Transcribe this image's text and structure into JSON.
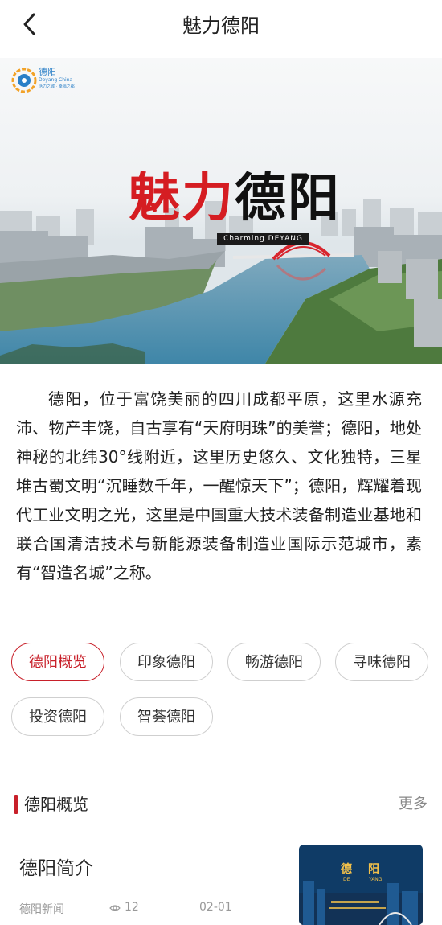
{
  "header": {
    "title": "魅力德阳"
  },
  "hero": {
    "logo_name": "德阳",
    "logo_sub": "Deyang China",
    "logo_tag": "活力之城 · 幸福之都",
    "brand_part1": "魅力",
    "brand_part2": "德阳",
    "brand_en": "Charming DEYANG"
  },
  "intro": "德阳，位于富饶美丽的四川成都平原，这里水源充沛、物产丰饶，自古享有“天府明珠”的美誉；德阳，地处神秘的北纬30°线附近，这里历史悠久、文化独特，三星堆古蜀文明“沉睡数千年，一醒惊天下”；德阳，辉耀着现代工业文明之光，这里是中国重大技术装备制造业基地和联合国清洁技术与新能源装备制造业国际示范城市，素有“智造名城”之称。",
  "chips": [
    {
      "label": "德阳概览",
      "active": true
    },
    {
      "label": "印象德阳",
      "active": false
    },
    {
      "label": "畅游德阳",
      "active": false
    },
    {
      "label": "寻味德阳",
      "active": false
    },
    {
      "label": "投资德阳",
      "active": false
    },
    {
      "label": "智荟德阳",
      "active": false
    }
  ],
  "section": {
    "title": "德阳概览",
    "more": "更多"
  },
  "article": {
    "title": "德阳简介",
    "source": "德阳新闻",
    "views": "12",
    "date": "02-01",
    "thumb_text1": "德",
    "thumb_text2": "阳",
    "thumb_text3": "DE",
    "thumb_text4": "YANG"
  },
  "colors": {
    "accent": "#c8202a",
    "muted": "#999999"
  }
}
